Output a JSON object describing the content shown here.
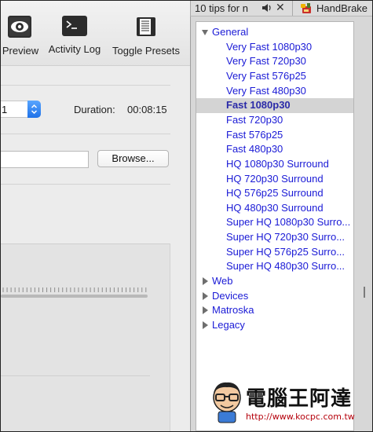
{
  "toolbar": {
    "preview_label": "Preview",
    "activity_log_label": "Activity Log",
    "toggle_presets_label": "Toggle Presets"
  },
  "source": {
    "title_value": "1",
    "duration_label": "Duration:",
    "duration_value": "00:08:15"
  },
  "destination": {
    "path_value": "",
    "browse_label": "Browse..."
  },
  "tabs": [
    {
      "label": "10 tips for n",
      "icons": [
        "speaker-icon",
        "close-icon"
      ]
    },
    {
      "label": "HandBrake",
      "icon": "handbrake-icon"
    }
  ],
  "sliver_text": "I",
  "presets": {
    "groups": [
      {
        "label": "General",
        "expanded": true,
        "items": [
          "Very Fast 1080p30",
          "Very Fast 720p30",
          "Very Fast 576p25",
          "Very Fast 480p30",
          "Fast 1080p30",
          "Fast 720p30",
          "Fast 576p25",
          "Fast 480p30",
          "HQ 1080p30 Surround",
          "HQ 720p30 Surround",
          "HQ 576p25 Surround",
          "HQ 480p30 Surround",
          "Super HQ 1080p30 Surro...",
          "Super HQ 720p30 Surro...",
          "Super HQ 576p25 Surro...",
          "Super HQ 480p30 Surro..."
        ],
        "selected": "Fast 1080p30"
      },
      {
        "label": "Web",
        "expanded": false
      },
      {
        "label": "Devices",
        "expanded": false
      },
      {
        "label": "Matroska",
        "expanded": false
      },
      {
        "label": "Legacy",
        "expanded": false
      }
    ]
  },
  "watermark": {
    "name": "電腦王阿達",
    "url": "http://www.kocpc.com.tw"
  },
  "colors": {
    "preset_link": "#1a1ad6",
    "selected_row": "#d4d4d4",
    "accent_blue": "#1f72e8",
    "watermark_url": "#b5000b"
  }
}
